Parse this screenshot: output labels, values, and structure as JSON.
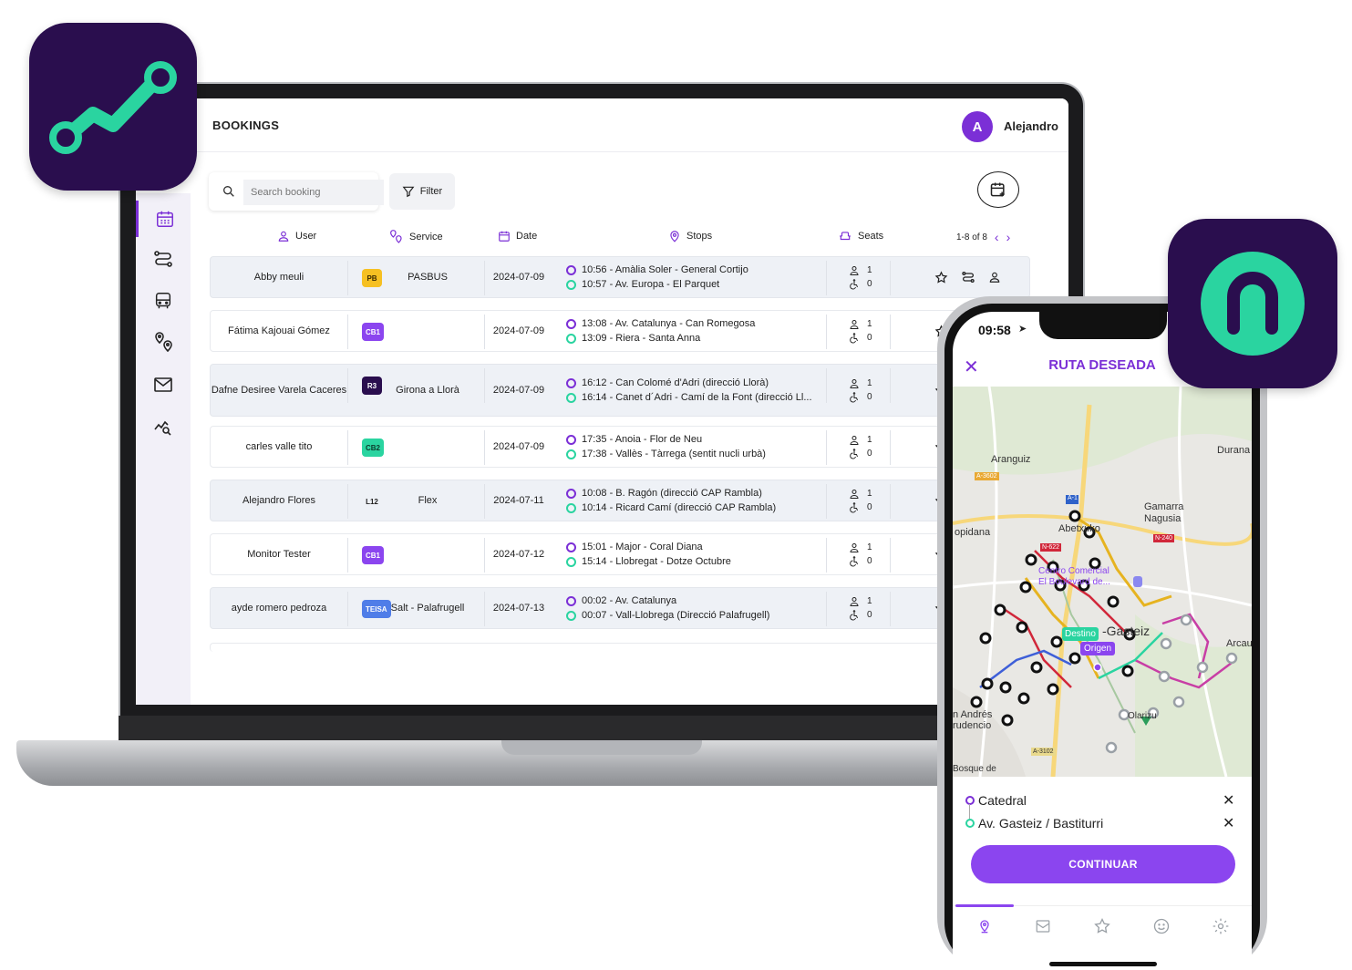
{
  "dashboard": {
    "page_title": "BOOKINGS",
    "user": {
      "initial": "A",
      "name": "Alejandro"
    },
    "search": {
      "placeholder": "Search booking"
    },
    "filter_label": "Filter",
    "columns": {
      "user": "User",
      "service": "Service",
      "date": "Date",
      "stops": "Stops",
      "seats": "Seats"
    },
    "pagination": "1-8 of 8",
    "rows": [
      {
        "user": "Abby meuli",
        "badge": "PB",
        "badge_bg": "#f6c022",
        "badge_fg": "#3a2a00",
        "service": "PASBUS",
        "date": "2024-07-09",
        "stop1": "10:56 - Amàlia Soler - General Cortijo",
        "stop2": "10:57 - Av. Europa - El Parquet",
        "seats": "1",
        "wheelchair": "0"
      },
      {
        "user": "Fátima Kajouai Gómez",
        "badge": "CB1",
        "badge_bg": "#8b45ef",
        "badge_fg": "#ffffff",
        "service": "",
        "date": "2024-07-09",
        "stop1": "13:08 - Av. Catalunya - Can Romegosa",
        "stop2": "13:09 - Riera - Santa Anna",
        "seats": "1",
        "wheelchair": "0"
      },
      {
        "user": "Dafne Desiree Varela Caceres",
        "badge": "R3",
        "badge_bg": "#2a0e4e",
        "badge_fg": "#ffffff",
        "service": "Girona a Llorà",
        "date": "2024-07-09",
        "stop1": "16:12 - Can Colomé d'Adri (direcció Llorà)",
        "stop2": "16:14 - Canet d´Adri - Camí de la Font (direcció Ll...",
        "seats": "1",
        "wheelchair": "0"
      },
      {
        "user": "carles valle tito",
        "badge": "CB2",
        "badge_bg": "#2ad4a0",
        "badge_fg": "#0c3a2c",
        "service": "",
        "date": "2024-07-09",
        "stop1": "17:35 - Anoia - Flor de Neu",
        "stop2": "17:38 - Vallès - Tàrrega (sentit nucli urbà)",
        "seats": "1",
        "wheelchair": "0"
      },
      {
        "user": "Alejandro Flores",
        "badge": "L12",
        "badge_bg": "transparent",
        "badge_fg": "#222222",
        "service": "Flex",
        "date": "2024-07-11",
        "stop1": "10:08 - B. Ragón (direcció CAP Rambla)",
        "stop2": "10:14 - Ricard Camí (direcció CAP Rambla)",
        "seats": "1",
        "wheelchair": "0"
      },
      {
        "user": "Monitor Tester",
        "badge": "CB1",
        "badge_bg": "#8b45ef",
        "badge_fg": "#ffffff",
        "service": "",
        "date": "2024-07-12",
        "stop1": "15:01 - Major - Coral Diana",
        "stop2": "15:14 - Llobregat - Dotze Octubre",
        "seats": "1",
        "wheelchair": "0"
      },
      {
        "user": "ayde romero pedroza",
        "badge": "TEISA",
        "badge_bg": "#4f7de8",
        "badge_fg": "#ffffff",
        "service": "Salt - Palafrugell",
        "date": "2024-07-13",
        "stop1": "00:02 - Av. Catalunya",
        "stop2": "00:07 - Vall-Llobrega (Direcció Palafrugell)",
        "seats": "1",
        "wheelchair": "0"
      }
    ]
  },
  "phone": {
    "time": "09:58",
    "title": "RUTA DESEADA",
    "map_labels": {
      "aranguiz": "Aranguiz",
      "durana": "Durana",
      "gamarra": "Gamarra",
      "nagusia": "Nagusia",
      "abetxuko": "Abetxuko",
      "lopidana": "opidana",
      "centro": "Centro Comercial",
      "boulevard": "El Boulevard de...",
      "gasteiz": "-Gasteiz",
      "destino": "Destino",
      "origen": "Origen",
      "arcau": "Arcau",
      "andres": "n Andrés",
      "prudencio": "rudencio",
      "olarizu": "Olarizu",
      "bosque": "Bosque de",
      "a3602": "A-3602",
      "a1": "A-1",
      "n622": "N-622",
      "n240": "N-240",
      "a3102": "A-3102"
    },
    "origin": "Catedral",
    "destination": "Av. Gasteiz / Bastiturri",
    "continue_label": "CONTINUAR"
  },
  "colors": {
    "accent": "#7b2fd6",
    "accent_light": "#8b45ef",
    "teal": "#2ad4a0",
    "icon_bg": "#2a0e4e"
  }
}
